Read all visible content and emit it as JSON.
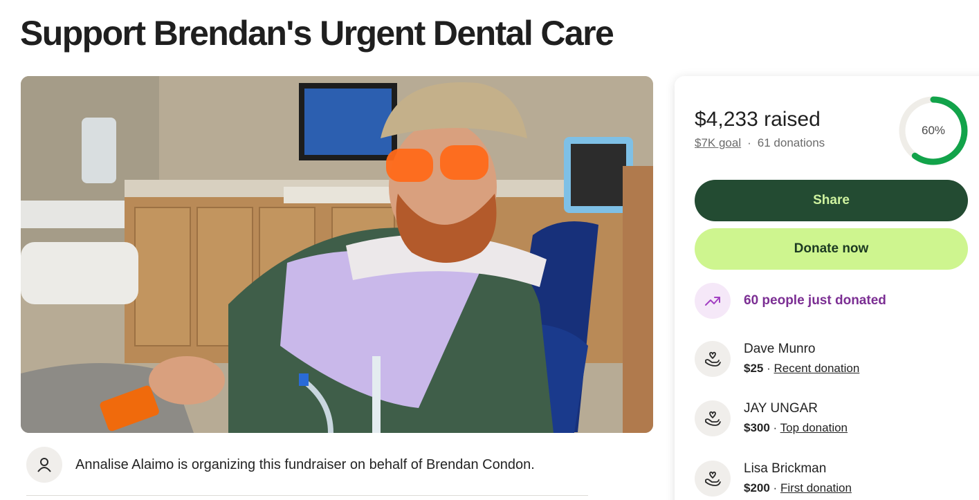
{
  "page": {
    "title": "Support Brendan's Urgent Dental Care"
  },
  "organizer": {
    "text": "Annalise Alaimo is organizing this fundraiser on behalf of Brendan Condon.",
    "icon": "person-icon"
  },
  "summary": {
    "raised": "$4,233 raised",
    "goal": "$7K goal",
    "separator": "·",
    "donations": "61 donations",
    "progress_percent": 60,
    "progress_label": "60%"
  },
  "buttons": {
    "share": "Share",
    "donate": "Donate now"
  },
  "activity": {
    "text": "60 people just donated",
    "icon": "trending-up-icon"
  },
  "donors": [
    {
      "name": "Dave Munro",
      "amount": "$25",
      "separator": " · ",
      "tag": "Recent donation",
      "icon": "heart-hand-icon"
    },
    {
      "name": "JAY UNGAR",
      "amount": "$300",
      "separator": " · ",
      "tag": "Top donation",
      "icon": "heart-hand-icon"
    },
    {
      "name": "Lisa Brickman",
      "amount": "$200",
      "separator": " · ",
      "tag": "First donation",
      "icon": "heart-hand-icon"
    }
  ],
  "colors": {
    "brand_dark": "#234b32",
    "brand_light": "#cef58f",
    "progress": "#12a34a",
    "accent_purple": "#7b2e93"
  }
}
